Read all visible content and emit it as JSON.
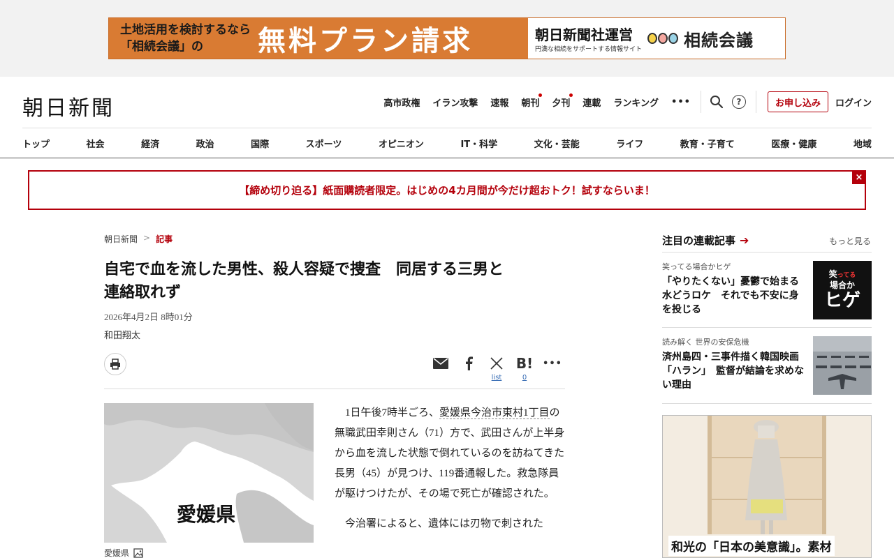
{
  "ad": {
    "line1": "土地活用を検討するなら",
    "line2": "「相続会議」の",
    "headline": "無料プラン請求",
    "org": "朝日新聞社運営",
    "org_sub": "円満な相続をサポートする情報サイト",
    "brand": "相続会議"
  },
  "header": {
    "logo": "朝日新聞",
    "top_links": [
      "高市政権",
      "イラン攻撃",
      "速報",
      "朝刊",
      "夕刊",
      "連載",
      "ランキング"
    ],
    "more": "•••",
    "help_symbol": "?",
    "subscribe_label": "お申し込み",
    "login_label": "ログイン"
  },
  "categories": [
    "トップ",
    "社会",
    "経済",
    "政治",
    "国際",
    "スポーツ",
    "オピニオン",
    "IT・科学",
    "文化・芸能",
    "ライフ",
    "教育・子育て",
    "医療・健康",
    "地域"
  ],
  "promo": {
    "text": "【締め切り迫る】紙面購読者限定。はじめの4カ月間が今だけ超おトク！試すならいま！",
    "close": "×"
  },
  "article": {
    "breadcrumb": [
      "朝日新聞",
      "記事"
    ],
    "breadcrumb_sep": ">",
    "headline_1": "自宅で血を流した男性、殺人容疑で捜査　同居する三男と",
    "headline_2": "連絡取れず",
    "date": "2026年4月2日 8時01分",
    "author": "和田翔太",
    "share": {
      "x_label": "list",
      "hatena_label": "B!",
      "hatena_count": "0",
      "more": "•••"
    },
    "figure": {
      "map_label": "愛媛県",
      "caption": "愛媛県"
    },
    "p1_a": "1日午後7時半ごろ、",
    "p1_link": "愛媛県今治市東村1丁目",
    "p1_b": "の無職武田幸則さん（71）方で、武田さんが上半身から血を流した状態で倒れているのを訪ねてきた長男（45）が見つけ、119番通報した。救急隊員が駆けつけたが、その場で死亡が確認された。",
    "p2": "今治署によると、遺体には刃物で刺された"
  },
  "sidebar": {
    "title": "注目の連載記事",
    "arrow": "➔",
    "more": "もっと見る",
    "items": [
      {
        "series": "笑ってる場合かヒゲ",
        "headline": "「やりたくない」憂鬱で始まる水どうロケ　それでも不安に身を投じる",
        "thumb_small_1": "笑",
        "thumb_small_2": "ってる",
        "thumb_small_3": "場合か",
        "thumb_big": "ヒゲ"
      },
      {
        "series": "読み解く 世界の安保危機",
        "headline": "済州島四・三事件描く韓国映画「ハラン」　監督が結論を求めない理由"
      }
    ],
    "ad_text": "和光の「日本の美意識」。素材"
  },
  "colors": {
    "brand_red": "#b4000b",
    "ad_orange": "#d97b33"
  }
}
